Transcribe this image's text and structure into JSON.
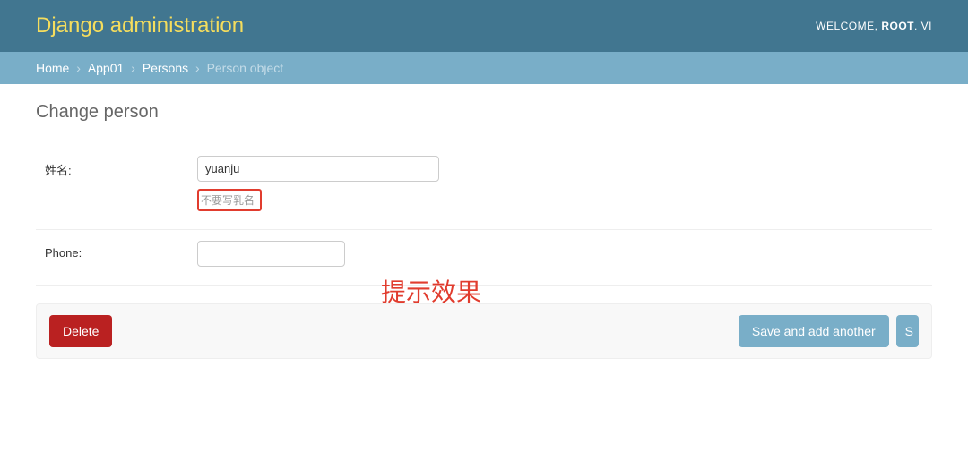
{
  "header": {
    "branding": "Django administration",
    "welcome_prefix": "WELCOME, ",
    "username": "ROOT",
    "after_user": ". VI"
  },
  "breadcrumbs": {
    "home": "Home",
    "app": "App01",
    "model": "Persons",
    "current": "Person object",
    "sep": "›"
  },
  "page": {
    "title": "Change person"
  },
  "form": {
    "name": {
      "label": "姓名:",
      "value": "yuanju",
      "help": "不要写乳名"
    },
    "phone": {
      "label": "Phone:",
      "value": ""
    }
  },
  "buttons": {
    "delete": "Delete",
    "save_add": "Save and add another",
    "save_partial": "S"
  },
  "annotation": {
    "text": "提示效果"
  }
}
